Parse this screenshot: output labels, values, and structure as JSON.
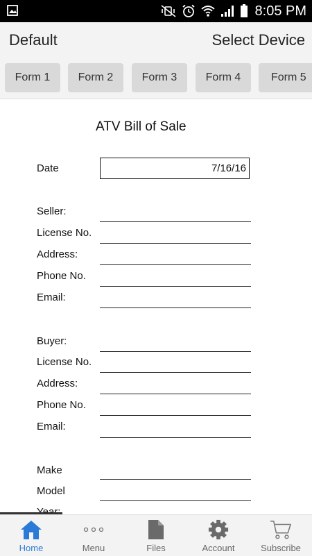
{
  "status_bar": {
    "time": "8:05 PM"
  },
  "app_bar": {
    "title": "Default",
    "action": "Select Device"
  },
  "tabs": [
    {
      "label": "Form 1"
    },
    {
      "label": "Form 2"
    },
    {
      "label": "Form 3"
    },
    {
      "label": "Form 4"
    },
    {
      "label": "Form 5"
    }
  ],
  "form": {
    "title": "ATV Bill of Sale",
    "date_label": "Date",
    "date_value": "7/16/16",
    "seller": {
      "seller_label": "Seller:",
      "license_label": "License No.",
      "address_label": "Address:",
      "phone_label": "Phone No.",
      "email_label": "Email:"
    },
    "buyer": {
      "buyer_label": "Buyer:",
      "license_label": "License No.",
      "address_label": "Address:",
      "phone_label": "Phone No.",
      "email_label": "Email:"
    },
    "vehicle": {
      "make_label": "Make",
      "model_label": "Model",
      "year_label": "Year:"
    }
  },
  "bottom_nav": {
    "items": [
      {
        "label": "Home",
        "icon": "home-icon",
        "active": true
      },
      {
        "label": "Menu",
        "icon": "more-dots-icon",
        "active": false
      },
      {
        "label": "Files",
        "icon": "file-icon",
        "active": false
      },
      {
        "label": "Account",
        "icon": "gear-icon",
        "active": false
      },
      {
        "label": "Subscribe",
        "icon": "cart-icon",
        "active": false
      }
    ]
  },
  "colors": {
    "accent": "#2b7bd6",
    "bar_background": "#f3f3f3",
    "tab_background": "#d9d9d9",
    "status_bar": "#000000"
  }
}
